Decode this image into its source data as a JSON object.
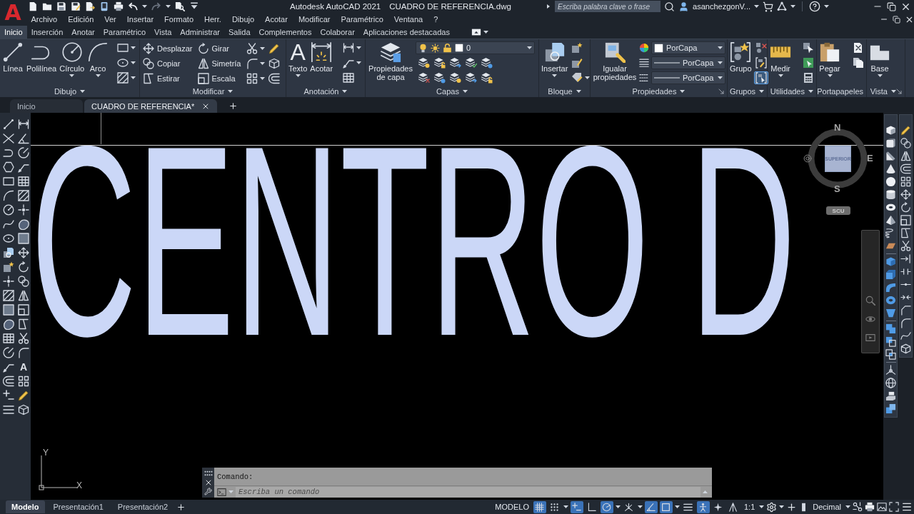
{
  "app_logo": "A",
  "title_bar": {
    "app_title": "Autodesk AutoCAD 2021",
    "document": "CUADRO DE REFERENCIA.dwg",
    "search": {
      "placeholder": "Escriba palabra clave o frase"
    },
    "user": "asanchezgonV..."
  },
  "menu_bar": [
    "Archivo",
    "Edición",
    "Ver",
    "Insertar",
    "Formato",
    "Herr.",
    "Dibujo",
    "Acotar",
    "Modificar",
    "Paramétrico",
    "Ventana",
    "?"
  ],
  "ribbon_tabs": [
    {
      "label": "Inicio",
      "selected": true
    },
    {
      "label": "Inserción",
      "selected": false
    },
    {
      "label": "Anotar",
      "selected": false
    },
    {
      "label": "Paramétrico",
      "selected": false
    },
    {
      "label": "Vista",
      "selected": false
    },
    {
      "label": "Administrar",
      "selected": false
    },
    {
      "label": "Salida",
      "selected": false
    },
    {
      "label": "Complementos",
      "selected": false
    },
    {
      "label": "Colaborar",
      "selected": false
    },
    {
      "label": "Aplicaciones destacadas",
      "selected": false
    }
  ],
  "ribbon_panels": [
    {
      "kind": "draw",
      "title": "Dibujo",
      "menu": true,
      "launcher": false,
      "tools": [
        {
          "label": "Línea",
          "dropdown": false
        },
        {
          "label": "Polilínea",
          "dropdown": false
        },
        {
          "label": "Círculo",
          "dropdown": true
        },
        {
          "label": "Arco",
          "dropdown": true
        }
      ]
    },
    {
      "kind": "modify",
      "title": "Modificar",
      "menu": true,
      "launcher": false,
      "tools": [
        {
          "label": "Desplazar"
        },
        {
          "label": "Girar"
        },
        {
          "label": "Copiar"
        },
        {
          "label": "Simetría"
        },
        {
          "label": "Estirar"
        },
        {
          "label": "Escala"
        }
      ]
    },
    {
      "kind": "annotate",
      "title": "Anotación",
      "menu": true,
      "launcher": false,
      "tools": [
        {
          "label": "Texto",
          "glyph": "A",
          "dropdown": true
        },
        {
          "label": "Acotar",
          "dropdown": false
        }
      ]
    },
    {
      "kind": "layers",
      "title": "Capas",
      "menu": true,
      "launcher": false,
      "tools": [
        {
          "label": "Propiedades de capa",
          "dropdown": false
        }
      ],
      "current_layer": "0"
    },
    {
      "kind": "block",
      "title": "Bloque",
      "menu": true,
      "launcher": false,
      "tools": [
        {
          "label": "Insertar",
          "dropdown": true
        }
      ]
    },
    {
      "kind": "properties",
      "title": "Propiedades",
      "menu": true,
      "launcher": true,
      "tools": [
        {
          "label": "Igualar propiedades",
          "dropdown": false
        }
      ],
      "combos": [
        {
          "kind": "color",
          "value": "PorCapa"
        },
        {
          "kind": "lineweight",
          "value": "PorCapa"
        },
        {
          "kind": "linetype",
          "value": "PorCapa"
        }
      ]
    },
    {
      "kind": "groups",
      "title": "Grupos",
      "menu": true,
      "launcher": false,
      "tools": [
        {
          "label": "Grupo",
          "dropdown": false
        }
      ],
      "toggles": [
        {
          "on": false
        },
        {
          "on": false
        },
        {
          "on": true
        }
      ]
    },
    {
      "kind": "utilities",
      "title": "Utilidades",
      "menu": true,
      "launcher": false,
      "tools": [
        {
          "label": "Medir",
          "dropdown": true
        }
      ]
    },
    {
      "kind": "clipboard",
      "title": "Portapapeles",
      "menu": false,
      "launcher": false,
      "tools": [
        {
          "label": "Pegar",
          "dropdown": true
        }
      ]
    },
    {
      "kind": "view",
      "title": "Vista",
      "menu": true,
      "launcher": true,
      "tools": [
        {
          "label": "Base",
          "dropdown": true
        }
      ]
    }
  ],
  "file_tabs": [
    {
      "label": "Inicio",
      "selected": false,
      "closable": false
    },
    {
      "label": "CUADRO DE REFERENCIA*",
      "selected": true,
      "closable": true
    }
  ],
  "left_toolbar": {
    "text_tool": "A"
  },
  "drawing": {
    "text": "CENTRO D"
  },
  "viewcube": {
    "north": "N",
    "east": "E",
    "south": "S",
    "face": "SUPERIOR",
    "ucs_menu": "SCU"
  },
  "ucs_icon": {
    "x_axis": "X",
    "y_axis": "Y"
  },
  "command_line": {
    "history": "Comando:",
    "input": {
      "placeholder": "Escriba un comando"
    }
  },
  "status_bar": {
    "layout_tabs": [
      {
        "label": "Modelo",
        "selected": true
      },
      {
        "label": "Presentación1",
        "selected": false
      },
      {
        "label": "Presentación2",
        "selected": false
      }
    ],
    "space": "MODELO",
    "toggles": [
      {
        "on": true
      },
      {
        "on": false
      },
      {
        "on": true
      },
      {
        "on": false
      },
      {
        "on": true
      },
      {
        "on": false
      },
      {
        "on": true
      },
      {
        "on": true
      },
      {
        "on": false
      },
      {
        "on": true
      },
      {
        "on": false
      },
      {
        "on": false
      }
    ],
    "scale": "1:1",
    "units": "Decimal"
  }
}
